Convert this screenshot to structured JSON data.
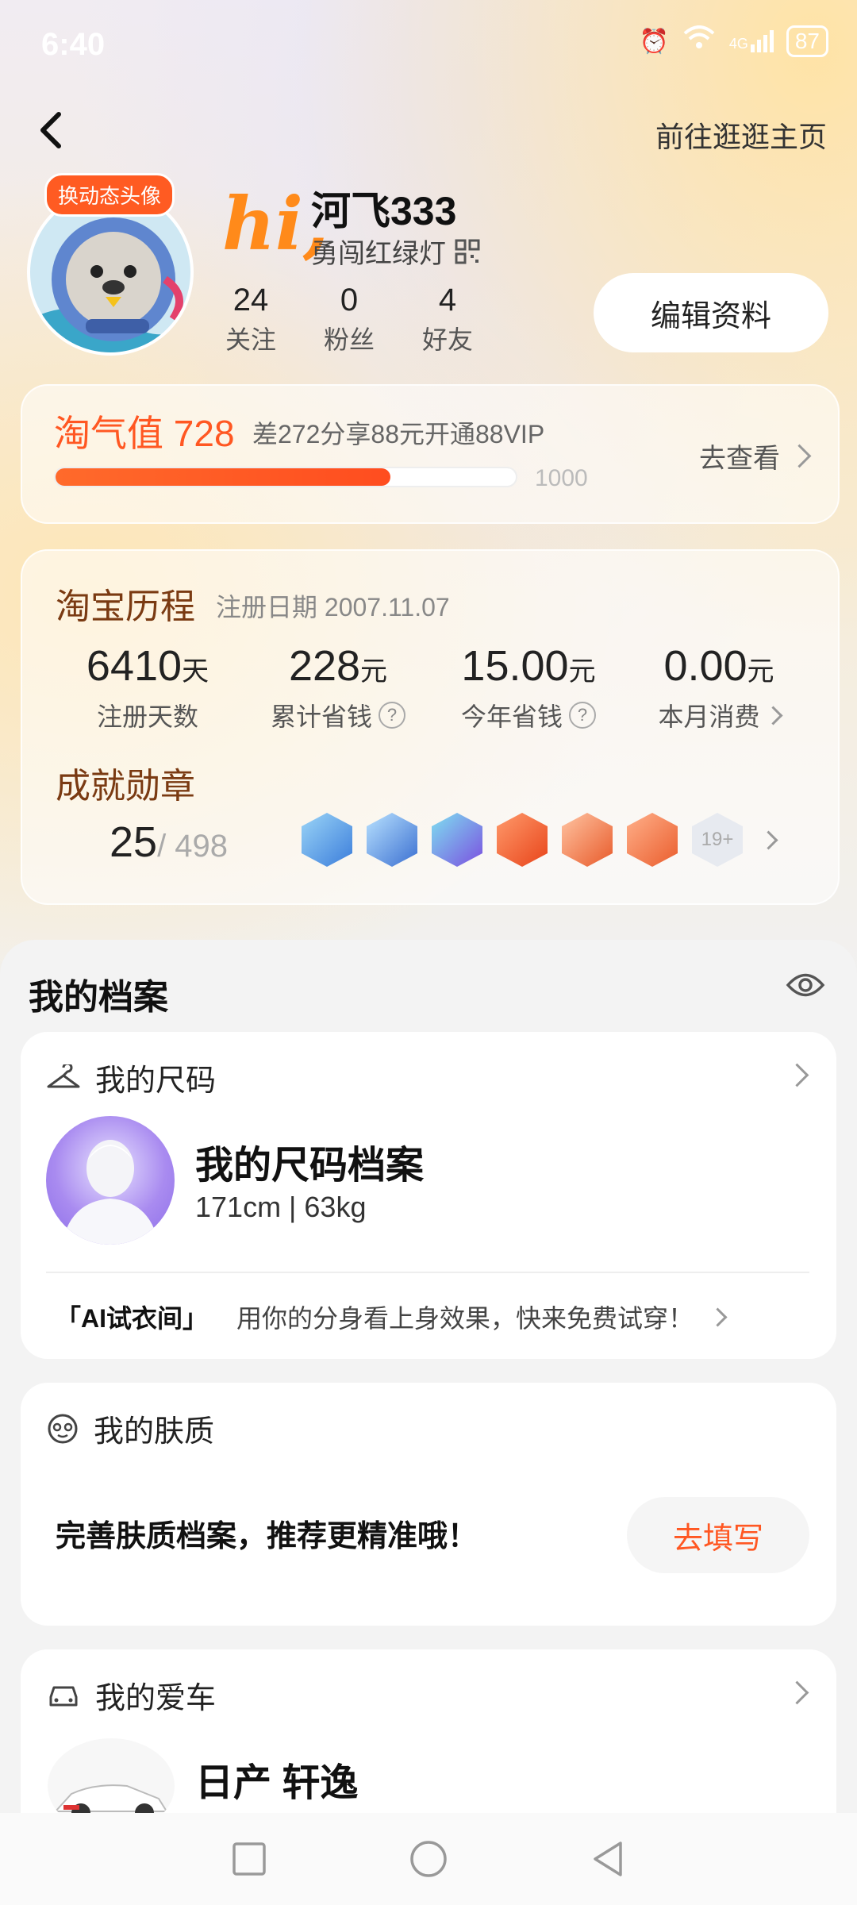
{
  "status": {
    "time": "6:40",
    "network": "4G",
    "battery": "87"
  },
  "header": {
    "go_home": "前往逛逛主页"
  },
  "profile": {
    "avatar_badge": "换动态头像",
    "greeting": "hi,",
    "username": "河飞333",
    "tag": "勇闯红绿灯",
    "stats": [
      {
        "num": "24",
        "label": "关注"
      },
      {
        "num": "0",
        "label": "粉丝"
      },
      {
        "num": "4",
        "label": "好友"
      }
    ],
    "edit_label": "编辑资料"
  },
  "taoqi": {
    "title": "淘气值 728",
    "subtitle": "差272分享88元开通88VIP",
    "progress": 0.728,
    "max": "1000",
    "look_label": "去查看"
  },
  "history": {
    "title": "淘宝历程",
    "reg_date": "注册日期 2007.11.07",
    "metrics": [
      {
        "value": "6410",
        "unit": "天",
        "label": "注册天数"
      },
      {
        "value": "228",
        "unit": "元",
        "label": "累计省钱"
      },
      {
        "value": "15.00",
        "unit": "元",
        "label": "今年省钱"
      },
      {
        "value": "0.00",
        "unit": "元",
        "label": "本月消费"
      }
    ],
    "medal_title": "成就勋章",
    "medal_count": "25",
    "medal_total": "/ 498",
    "medal_more": "19+"
  },
  "archive": {
    "title": "我的档案",
    "size": {
      "title": "我的尺码",
      "card_title": "我的尺码档案",
      "card_value": "171cm | 63kg",
      "ai_label": "「AI试衣间」",
      "ai_text": "用你的分身看上身效果，快来免费试穿！"
    },
    "skin": {
      "title": "我的肤质",
      "text": "完善肤质档案，推荐更精准哦！",
      "button": "去填写"
    },
    "car": {
      "title": "我的爱车",
      "name": "日产 轩逸"
    }
  },
  "colors": {
    "accent": "#ff5722",
    "progress": "#ff5a23"
  }
}
